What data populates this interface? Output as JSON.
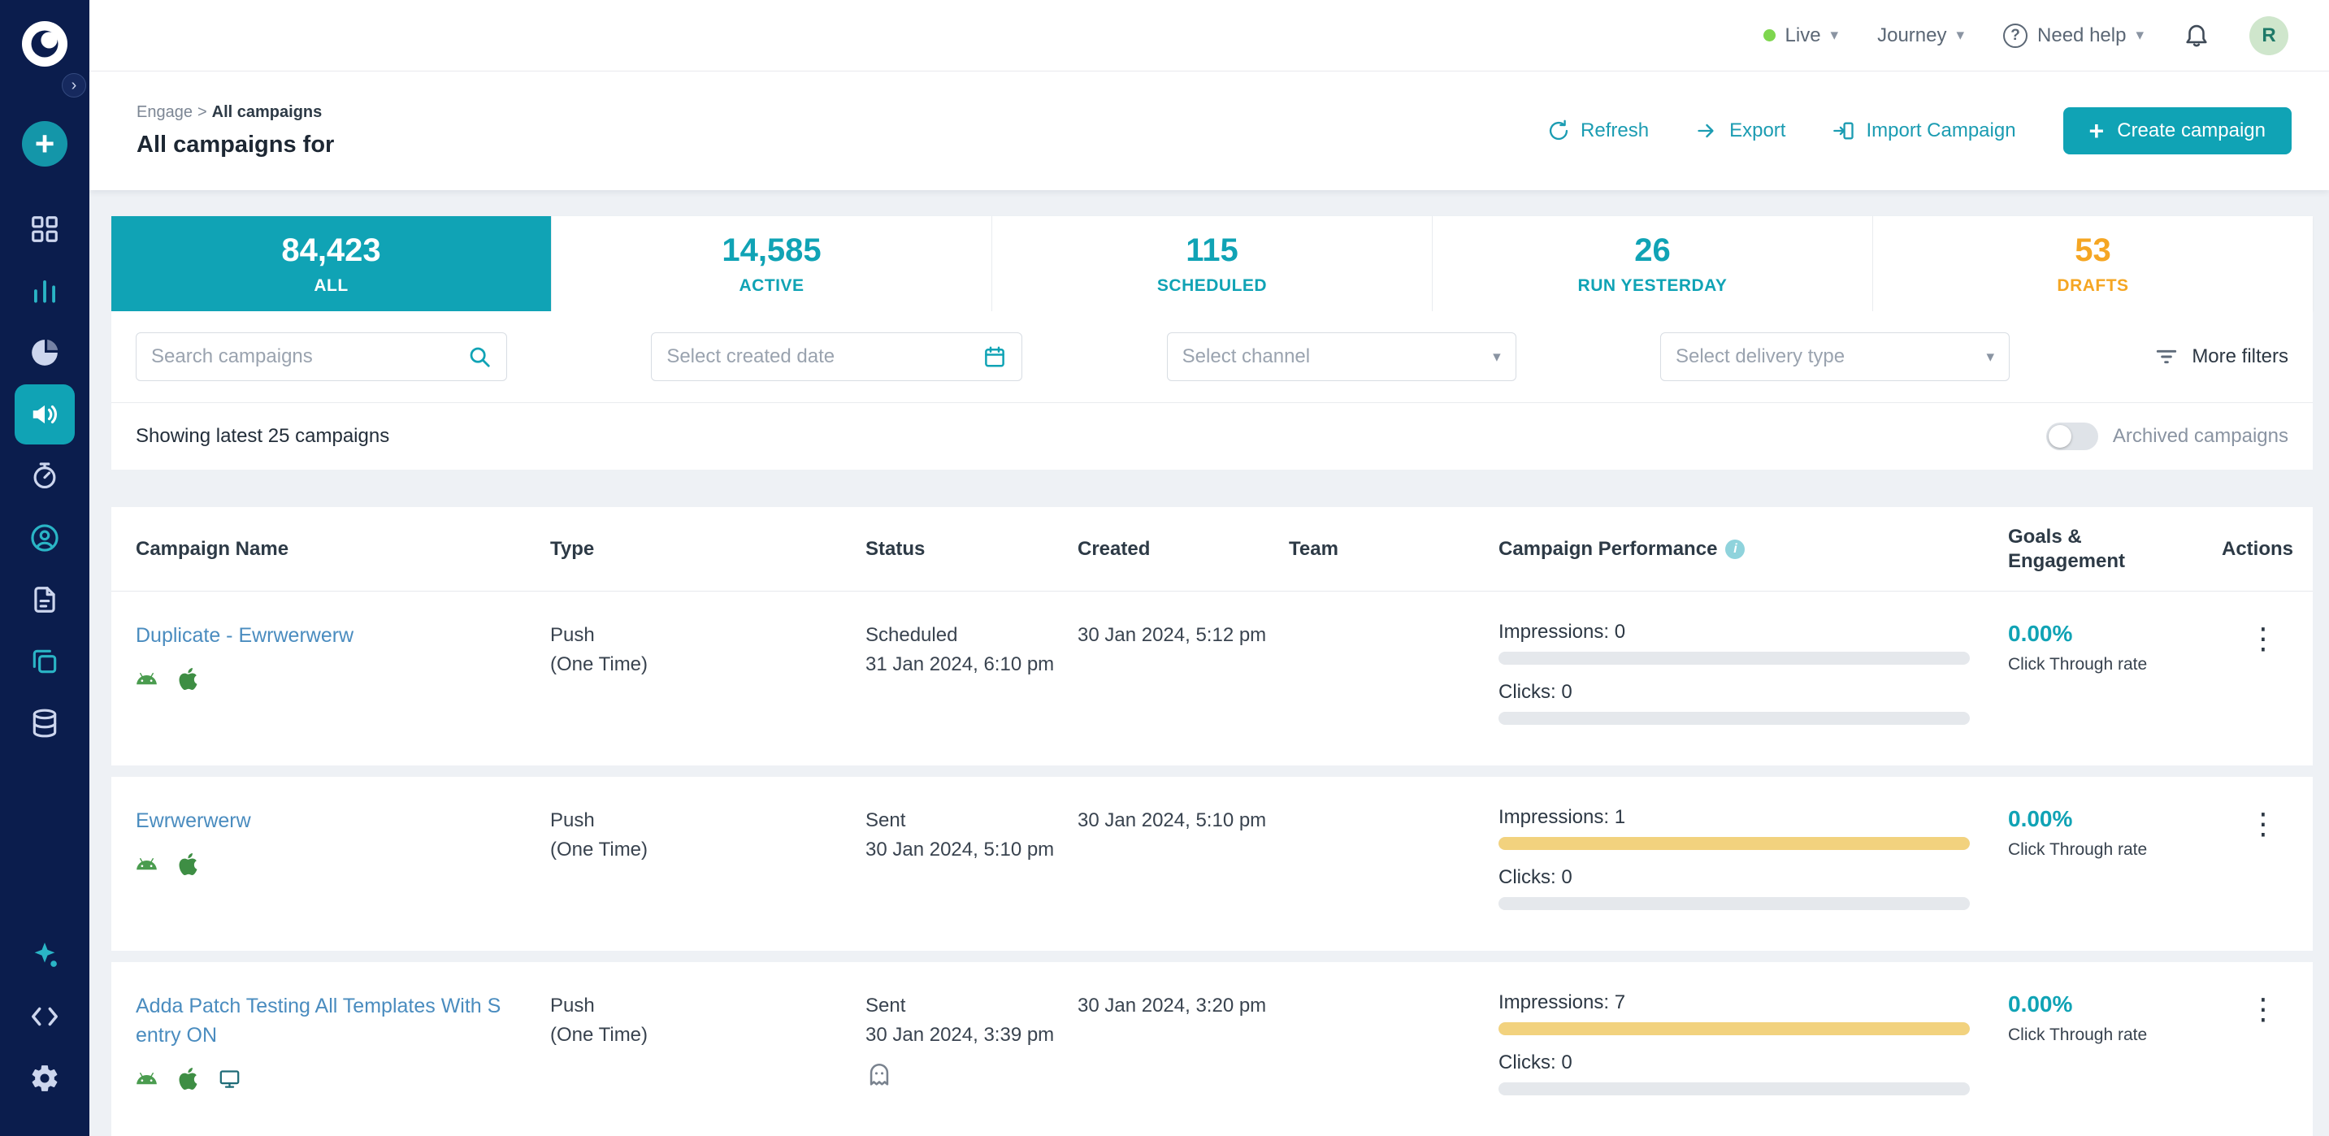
{
  "topbar": {
    "live_label": "Live",
    "journey_label": "Journey",
    "need_help_label": "Need help",
    "avatar_initial": "R"
  },
  "breadcrumb": {
    "section": "Engage",
    "separator": ">",
    "page": "All campaigns"
  },
  "header": {
    "title": "All campaigns for",
    "refresh_label": "Refresh",
    "export_label": "Export",
    "import_label": "Import Campaign",
    "create_label": "Create campaign"
  },
  "stats_tabs": [
    {
      "value": "84,423",
      "label": "ALL"
    },
    {
      "value": "14,585",
      "label": "ACTIVE"
    },
    {
      "value": "115",
      "label": "SCHEDULED"
    },
    {
      "value": "26",
      "label": "RUN YESTERDAY"
    },
    {
      "value": "53",
      "label": "DRAFTS"
    }
  ],
  "filters": {
    "search_placeholder": "Search campaigns",
    "created_date_placeholder": "Select created date",
    "channel_placeholder": "Select channel",
    "delivery_type_placeholder": "Select delivery type",
    "more_filters_label": "More filters"
  },
  "list_meta": {
    "showing_text": "Showing latest 25 campaigns",
    "archived_label": "Archived campaigns",
    "archived_on": false
  },
  "table": {
    "columns": [
      "Campaign Name",
      "Type",
      "Status",
      "Created",
      "Team",
      "Campaign Performance",
      "Goals & Engagement",
      "Actions"
    ],
    "rows": [
      {
        "name": "Duplicate - Ewrwerwerw",
        "platforms": [
          "android",
          "apple"
        ],
        "type_line1": "Push",
        "type_line2": "(One Time)",
        "status": "Scheduled",
        "status_date": "31 Jan 2024, 6:10 pm",
        "created": "30 Jan 2024, 5:12 pm",
        "team": "",
        "impressions_label": "Impressions: 0",
        "impressions_pct": 0,
        "clicks_label": "Clicks: 0",
        "clicks_pct": 0,
        "goal_value": "0.00%",
        "goal_label": "Click Through rate"
      },
      {
        "name": "Ewrwerwerw",
        "platforms": [
          "android",
          "apple"
        ],
        "type_line1": "Push",
        "type_line2": "(One Time)",
        "status": "Sent",
        "status_date": "30 Jan 2024, 5:10 pm",
        "created": "30 Jan 2024, 5:10 pm",
        "team": "",
        "impressions_label": "Impressions: 1",
        "impressions_pct": 100,
        "clicks_label": "Clicks: 0",
        "clicks_pct": 0,
        "goal_value": "0.00%",
        "goal_label": "Click Through rate"
      },
      {
        "name": "Adda Patch Testing All Templates With S entry ON",
        "platforms": [
          "android",
          "apple",
          "desktop"
        ],
        "type_line1": "Push",
        "type_line2": "(One Time)",
        "status": "Sent",
        "status_date": "30 Jan 2024, 3:39 pm",
        "created": "30 Jan 2024, 3:20 pm",
        "team": "",
        "impressions_label": "Impressions: 7",
        "impressions_pct": 100,
        "clicks_label": "Clicks: 0",
        "clicks_pct": 0,
        "goal_value": "0.00%",
        "goal_label": "Click Through rate"
      }
    ]
  },
  "sidebar": {
    "icons": [
      "logo",
      "expand",
      "create-new",
      "dashboard",
      "analytics",
      "segments",
      "campaigns",
      "recent",
      "account",
      "documents",
      "templates",
      "data",
      "integrations",
      "developer",
      "settings"
    ],
    "active_icon": "campaigns"
  },
  "icons": {
    "plus": "+",
    "caret": "▾",
    "chevron_right": "›",
    "ellipsis": "⋮",
    "question_mark": "?",
    "info": "i"
  },
  "colors": {
    "accent_teal": "#10a3b5",
    "drafts_orange": "#f5a623",
    "bar_yellow": "#f2d27e",
    "sidebar_navy": "#0b1d4d",
    "link_blue": "#4a8cbf"
  }
}
